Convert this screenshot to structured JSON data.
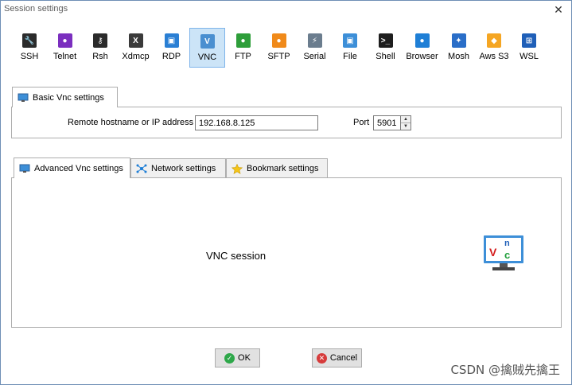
{
  "window": {
    "title": "Session settings",
    "close_glyph": "✕"
  },
  "protocols": [
    {
      "label": "SSH",
      "icon": "ssh-wrench-icon",
      "color": "#2b2b2b",
      "glyph": "🔧"
    },
    {
      "label": "Telnet",
      "icon": "telnet-icon",
      "color": "#7b2fbf",
      "glyph": "●"
    },
    {
      "label": "Rsh",
      "icon": "rsh-icon",
      "color": "#2b2b2b",
      "glyph": "⚷"
    },
    {
      "label": "Xdmcp",
      "icon": "xdmcp-icon",
      "color": "#3a3a3a",
      "glyph": "X"
    },
    {
      "label": "RDP",
      "icon": "rdp-monitor-icon",
      "color": "#2a7fd4",
      "glyph": "▣"
    },
    {
      "label": "VNC",
      "icon": "vnc-icon",
      "color": "#4a8fd0",
      "glyph": "V"
    },
    {
      "label": "FTP",
      "icon": "ftp-globe-icon",
      "color": "#2e9e3a",
      "glyph": "●"
    },
    {
      "label": "SFTP",
      "icon": "sftp-icon",
      "color": "#f08a1a",
      "glyph": "●"
    },
    {
      "label": "Serial",
      "icon": "serial-plug-icon",
      "color": "#6b7d8e",
      "glyph": "⚡"
    },
    {
      "label": "File",
      "icon": "file-monitor-icon",
      "color": "#3d8fd8",
      "glyph": "▣"
    },
    {
      "label": "Shell",
      "icon": "shell-terminal-icon",
      "color": "#1e1e1e",
      "glyph": ">_"
    },
    {
      "label": "Browser",
      "icon": "browser-globe-icon",
      "color": "#1f7fd6",
      "glyph": "●"
    },
    {
      "label": "Mosh",
      "icon": "mosh-satellite-icon",
      "color": "#2a6ec8",
      "glyph": "✦"
    },
    {
      "label": "Aws S3",
      "icon": "aws-s3-icon",
      "color": "#f5a623",
      "glyph": "◆"
    },
    {
      "label": "WSL",
      "icon": "wsl-windows-icon",
      "color": "#1f5fb8",
      "glyph": "⊞"
    }
  ],
  "selected_protocol": "VNC",
  "basic": {
    "tab_label": "Basic Vnc settings",
    "host_label": "Remote hostname or IP address *",
    "host_value": "192.168.8.125",
    "port_label": "Port",
    "port_value": "5901"
  },
  "tabs": [
    {
      "label": "Advanced Vnc settings",
      "icon": "monitor-icon"
    },
    {
      "label": "Network settings",
      "icon": "network-icon"
    },
    {
      "label": "Bookmark settings",
      "icon": "star-icon"
    }
  ],
  "session_text": "VNC session",
  "buttons": {
    "ok": "OK",
    "cancel": "Cancel"
  },
  "watermark": "CSDN @擒贼先擒王"
}
